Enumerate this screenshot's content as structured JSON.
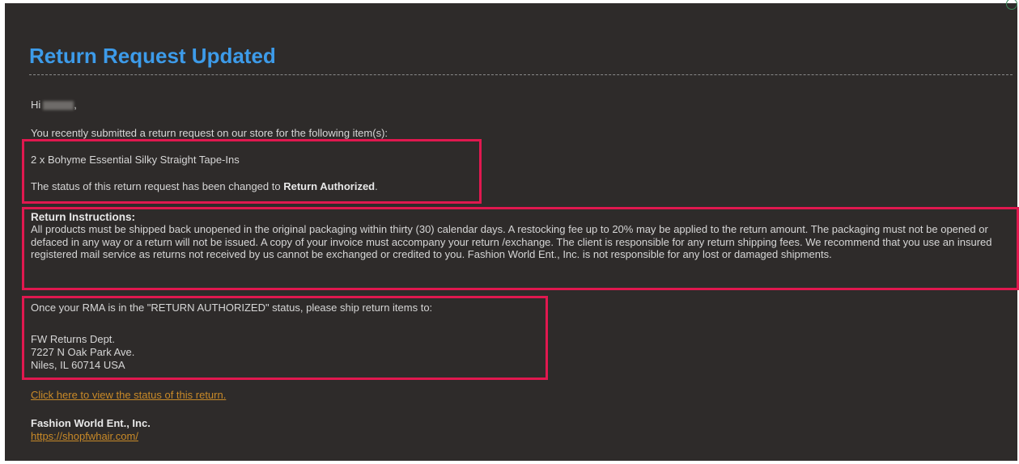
{
  "email": {
    "title": "Return Request Updated",
    "greeting_prefix": "Hi",
    "greeting_suffix": ",",
    "intro": "You recently submitted a return request on our store for the following item(s):",
    "item": "2 x Bohyme Essential Silky Straight Tape-Ins",
    "status_prefix": "The status of this return request has been changed to",
    "status_value": "Return Authorized",
    "status_suffix": ".",
    "instructions_heading": "Return Instructions:",
    "instructions_body": "All products must be shipped back unopened in the original packaging within thirty (30) calendar days. A restocking fee up to 20% may be applied to the return amount. The packaging must not be opened or defaced in any way or a return will not be issued. A copy of your invoice must accompany your return /exchange. The client is responsible for any return shipping fees. We recommend that you use an insured registered mail service as returns not received by us cannot be exchanged or credited to you. Fashion World Ent., Inc. is not responsible for any lost or damaged shipments.",
    "ship_instruction": "Once your RMA is in the \"RETURN AUTHORIZED\" status, please ship return items to:",
    "address": {
      "line1": "FW Returns Dept.",
      "line2": "7227 N Oak Park Ave.",
      "line3": "Niles, IL 60714 USA"
    },
    "status_link": "Click here to view the status of this return.",
    "company": "Fashion World Ent., Inc.",
    "website": "https://shopfwhair.com/"
  },
  "colors": {
    "background": "#2e2b2a",
    "title": "#3d9be9",
    "text": "#d6d6d6",
    "link": "#c98a28",
    "highlight_box": "#e0184f"
  }
}
